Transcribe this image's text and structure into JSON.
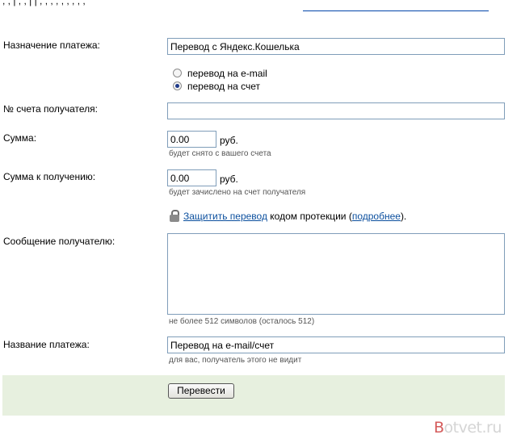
{
  "top_fragment": {
    "text": "  , ,   |   ,   ,   |   |   ,   ,   ,  ,   ,  ,  ,  ,  ,  "
  },
  "payment_purpose": {
    "label": "Назначение платежа:",
    "value": "Перевод с Яндекс.Кошелька"
  },
  "transfer_type": {
    "options": [
      {
        "label": "перевод на e-mail",
        "selected": false
      },
      {
        "label": "перевод на счет",
        "selected": true
      }
    ]
  },
  "recipient_account": {
    "label": "№ счета получателя:",
    "value": ""
  },
  "amount": {
    "label": "Сумма:",
    "value": "0.00",
    "unit": "руб.",
    "hint": "будет снято с вашего счета"
  },
  "amount_received": {
    "label": "Сумма к получению:",
    "value": "0.00",
    "unit": "руб.",
    "hint": "будет зачислено на счет получателя"
  },
  "protection": {
    "link_text": "Защитить перевод",
    "middle_text": " кодом протекции (",
    "details_link_text": "подробнее",
    "end_text": ")."
  },
  "message": {
    "label": "Сообщение получателю:",
    "value": "",
    "hint": "не более 512 символов (осталось 512)"
  },
  "payment_name": {
    "label": "Название платежа:",
    "value": "Перевод на e-mail/счет",
    "hint": "для вас, получатель этого не видит"
  },
  "submit": {
    "label": "Перевести"
  },
  "watermark": {
    "first_letter": "B",
    "rest": "otvet.ru"
  },
  "colors": {
    "footer_band": "#e7f0df",
    "link": "#0b4f9e",
    "input_border": "#7f9db9",
    "hint": "#555555"
  }
}
